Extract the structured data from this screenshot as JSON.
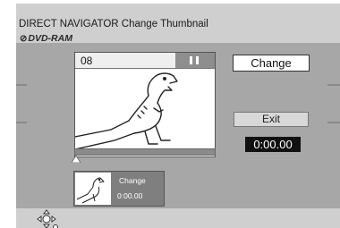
{
  "header": {
    "title": "DIRECT NAVIGATOR  Change Thumbnail",
    "disc_label": "DVD-RAM",
    "disc_icon": "disc-icon"
  },
  "preview": {
    "chapter_number": "08",
    "play_state_icon": "pause-icon",
    "image_subject": "dinosaur-illustration"
  },
  "progress": {
    "position_fraction": 0.0,
    "marker_icon": "triangle-up-icon"
  },
  "thumbnail": {
    "label": "Change",
    "time": "0:00.00"
  },
  "buttons": {
    "change_label": "Change",
    "exit_label": "Exit"
  },
  "time_display": {
    "value": "0:00.00"
  },
  "footer": {
    "nav_icon": "navigation-cross-icon"
  },
  "colors": {
    "panel_bg": "#a7a7a7",
    "header_bg": "#cfcfcf",
    "time_box_bg": "#111111",
    "thumb_bg": "#7f7f7f"
  }
}
